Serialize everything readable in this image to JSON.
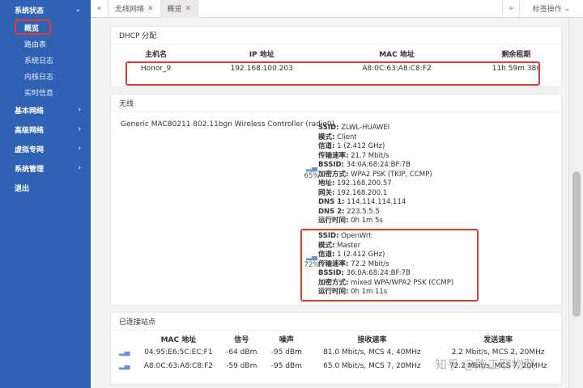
{
  "sidebar": {
    "groups": [
      {
        "label": "系统状态",
        "chevron": "⌄"
      },
      {
        "label": "基本网络",
        "chevron": "›"
      },
      {
        "label": "高级网络",
        "chevron": "›"
      },
      {
        "label": "虚拟专网",
        "chevron": "›"
      },
      {
        "label": "系统管理",
        "chevron": "›"
      },
      {
        "label": "退出"
      }
    ],
    "subitems": [
      "概览",
      "路由表",
      "系统日志",
      "内核日志",
      "实时信息"
    ]
  },
  "tabbar": {
    "prev": "«",
    "tabs": [
      {
        "label": "无线网络",
        "close": "✕"
      },
      {
        "label": "概览",
        "close": "✕"
      }
    ],
    "next": "»",
    "ops_label": "标签操作",
    "ops_chevron": "⌄"
  },
  "dhcp": {
    "title": "DHCP 分配",
    "headers": [
      "主机名",
      "IP 地址",
      "MAC 地址",
      "剩余租期"
    ],
    "rows": [
      {
        "host": "Honor_9",
        "ip": "192.168.100.203",
        "mac": "A8:0C:63:A8:C8:F2",
        "lease": "11h 59m 38s"
      }
    ]
  },
  "wireless": {
    "title": "无线",
    "controller": "Generic MAC80211 802.11bgn Wireless Controller (radio0)",
    "networks": [
      {
        "signal": "65%",
        "rows": [
          {
            "k": "SSID:",
            "v": "ZLWL-HUAWEI"
          },
          {
            "k": "模式:",
            "v": "Client"
          },
          {
            "k": "信道:",
            "v": "1 (2.412 GHz)"
          },
          {
            "k": "传输速率:",
            "v": "21.7 Mbit/s"
          },
          {
            "k": "BSSID:",
            "v": "34:0A:68:24:BF:7B"
          },
          {
            "k": "加密方式:",
            "v": "WPA2 PSK (TKIP, CCMP)"
          },
          {
            "k": "地址:",
            "v": "192.168.200.57"
          },
          {
            "k": "网关:",
            "v": "192.168.200.1"
          },
          {
            "k": "DNS 1:",
            "v": "114.114.114.114"
          },
          {
            "k": "DNS 2:",
            "v": "223.5.5.5"
          },
          {
            "k": "运行时间:",
            "v": "0h 1m 5s"
          }
        ]
      },
      {
        "signal": "72%",
        "rows": [
          {
            "k": "SSID:",
            "v": "OpenWrt"
          },
          {
            "k": "模式:",
            "v": "Master"
          },
          {
            "k": "信道:",
            "v": "1 (2.412 GHz)"
          },
          {
            "k": "传输速率:",
            "v": "72.2 Mbit/s"
          },
          {
            "k": "BSSID:",
            "v": "36:0A:68:24:BF:7B"
          },
          {
            "k": "加密方式:",
            "v": "mixed WPA/WPA2 PSK (CCMP)"
          },
          {
            "k": "运行时间:",
            "v": "0h 1m 11s"
          }
        ]
      }
    ]
  },
  "stations": {
    "title": "已连接站点",
    "headers": [
      "MAC 地址",
      "信号",
      "噪声",
      "接收速率",
      "发送速率"
    ],
    "rows": [
      {
        "mac": "04:95:E6:5C:EC:F1",
        "signal": "-64 dBm",
        "noise": "-95 dBm",
        "rx": "81.0 Mbit/s, MCS 4, 40MHz",
        "tx": "2.2 Mbit/s, MCS 2, 20MHz"
      },
      {
        "mac": "A8:0C:63:A8:C8:F2",
        "signal": "-59 dBm",
        "noise": "-95 dBm",
        "rx": "65.0 Mbit/s, MCS 7, 20MHz",
        "tx": "72.2 Mbit/s, MCS 7, 20MHz"
      }
    ]
  },
  "watermark": "知乎 @陈工聊物联",
  "colors": {
    "sidebar": "#2f62b3",
    "highlight": "#e53935"
  }
}
